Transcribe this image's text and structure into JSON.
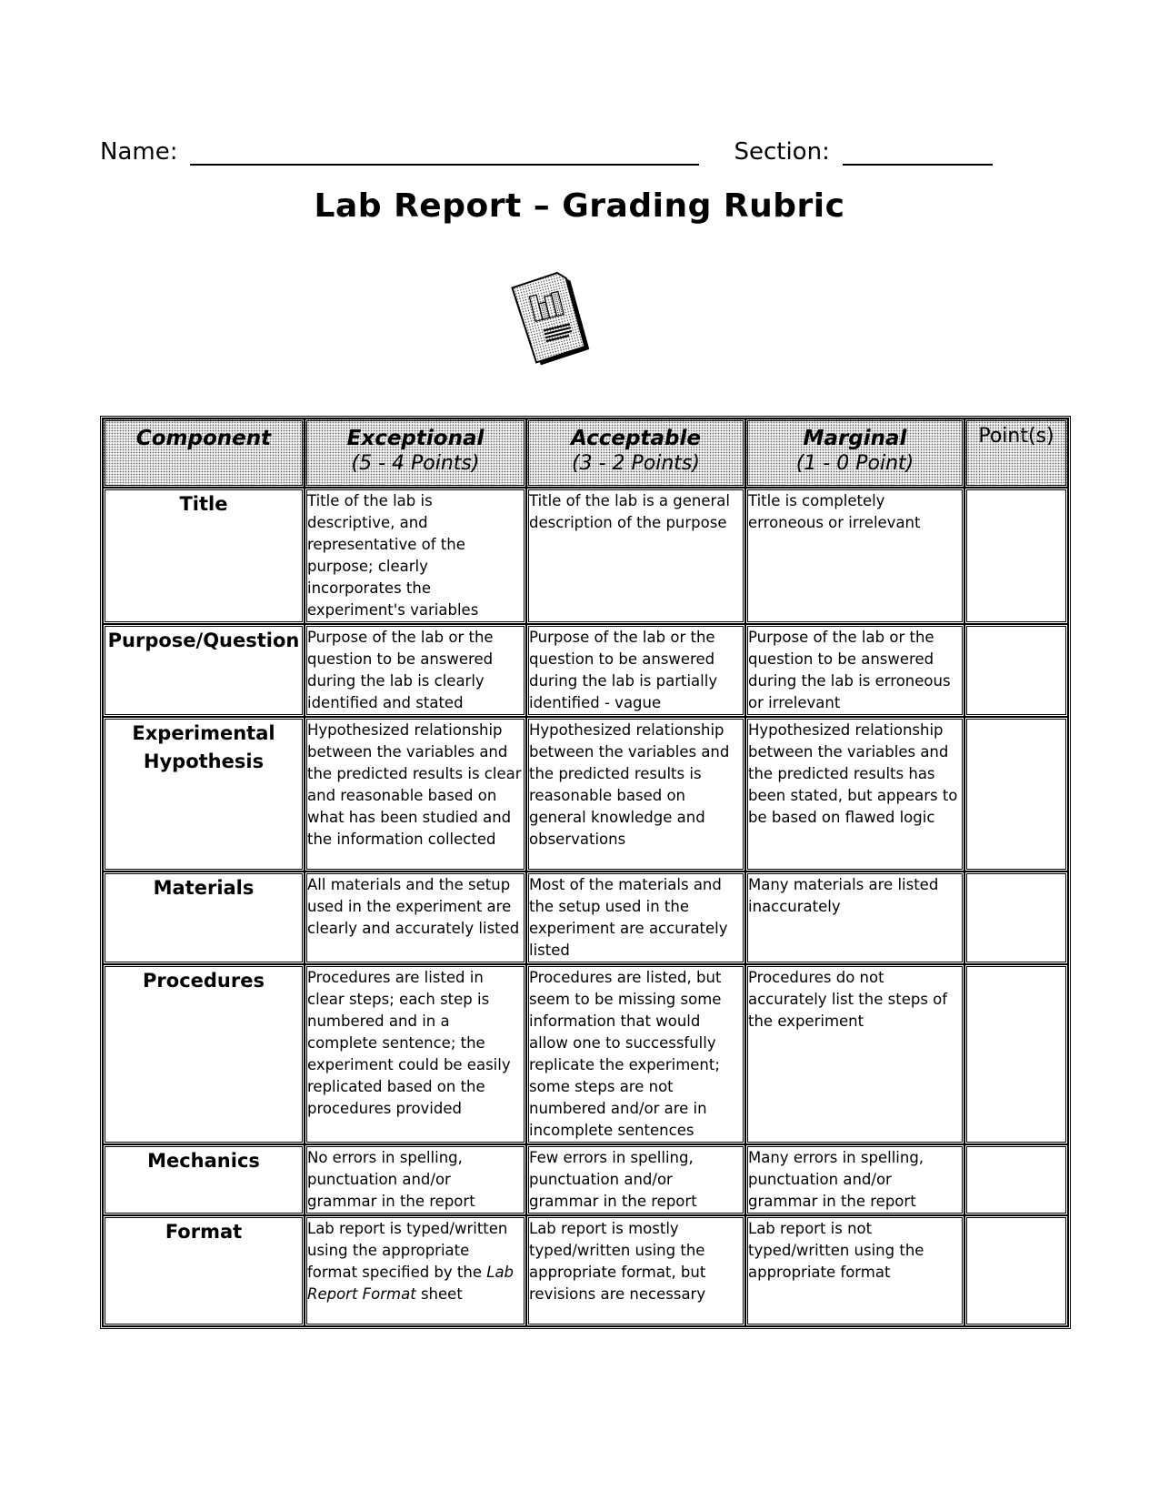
{
  "header": {
    "name_label": "Name:",
    "section_label": "Section:",
    "title": "Lab Report – Grading Rubric",
    "icon": "lab-report-document-icon"
  },
  "table": {
    "headers": [
      {
        "title": "Component",
        "subtitle": ""
      },
      {
        "title": "Exceptional",
        "subtitle": "(5 - 4 Points)"
      },
      {
        "title": "Acceptable",
        "subtitle": "(3 - 2 Points)"
      },
      {
        "title": "Marginal",
        "subtitle": "(1 - 0 Point)"
      },
      {
        "title": "Point(s)",
        "subtitle": ""
      }
    ],
    "rows": [
      {
        "component": "Title",
        "exceptional": "Title of the lab is descriptive, and representative of the purpose; clearly incorporates the experiment's variables",
        "acceptable": "Title of the lab is a general description of the purpose",
        "marginal": "Title is completely erroneous or irrelevant",
        "points": ""
      },
      {
        "component": "Purpose/Question",
        "exceptional": "Purpose of the lab or the question to be answered during the lab is clearly identified and stated",
        "acceptable": "Purpose of the lab or the question to be answered during the lab is partially identified - vague",
        "marginal": "Purpose of the lab or the question to be answered during the lab is erroneous or irrelevant",
        "points": ""
      },
      {
        "component": "Experimental Hypothesis",
        "exceptional": "Hypothesized relationship between the variables and the predicted results is clear and reasonable based on what has been studied and the information collected",
        "acceptable": "Hypothesized relationship between the variables and the predicted results is reasonable based on general knowledge and observations",
        "marginal": "Hypothesized relationship between the variables and the predicted results has been stated, but appears to be based on flawed logic",
        "points": ""
      },
      {
        "component": "Materials",
        "exceptional": "All materials and the setup used in the experiment are clearly and accurately listed",
        "acceptable": "Most of the materials and the setup used in the experiment are accurately listed",
        "marginal": "Many materials are listed inaccurately",
        "points": ""
      },
      {
        "component": "Procedures",
        "exceptional": "Procedures are listed in clear steps; each step is numbered and in a complete sentence; the experiment could be easily replicated based on the procedures provided",
        "acceptable": "Procedures are listed, but seem to be missing some information that would allow one to successfully replicate the experiment; some steps are not numbered and/or are in incomplete sentences",
        "marginal": "Procedures do not accurately list the steps of the experiment",
        "points": ""
      },
      {
        "component": "Mechanics",
        "exceptional": "No errors in spelling, punctuation and/or grammar in the report",
        "acceptable": "Few errors in spelling, punctuation and/or grammar in the report",
        "marginal": "Many errors in spelling, punctuation and/or grammar in the report",
        "points": ""
      },
      {
        "component": "Format",
        "exceptional_prefix": "Lab report is typed/written using the appropriate format specified by the ",
        "exceptional_italic": "Lab Report Format",
        "exceptional_suffix": " sheet",
        "acceptable": "Lab report is mostly typed/written using the appropriate format, but revisions are necessary",
        "marginal": "Lab report is not typed/written using the appropriate format",
        "points": ""
      }
    ]
  }
}
